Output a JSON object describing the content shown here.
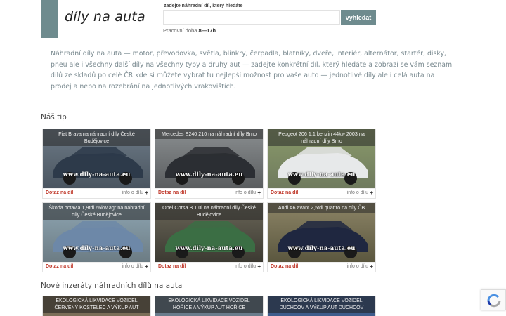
{
  "header": {
    "logo_text": "díly na auta",
    "search_caption": "zadejte náhradní díl, který hledáte",
    "search_placeholder": "",
    "search_button": "vyhledat",
    "hours_label": "Pracovní doba",
    "hours_value": "8—17h"
  },
  "intro": "Náhradní díly na auta — motor, převodovka, světla, blinkry, čerpadla, blatníky, dveře, interiér, alternátor, startér, disky, pneu ale i všechny další díly na všechny typy a druhy aut — zadejte konkrétní díl, který hledáte a zobrazí se vám seznam dílů ze skladů po celé ČR kde si můžete vybrat tu nejlepší možnost pro vaše auto — jednotlivé díly ale i celá auta na prodej a nebo na rozebrání na jednotlivých vrakovištích.",
  "tip_title": "Náš tip",
  "card_common": {
    "ask": "Dotaz na díl",
    "info": "info o dílu",
    "plus": "+",
    "watermark": "www.dily-na-auta.eu"
  },
  "tip_cards": [
    {
      "caption": "Fiat Brava na náhradní díly České Budějovice",
      "top": "#6d7a86",
      "bottom": "#4a5560",
      "car": "#2d3a4a"
    },
    {
      "caption": "Mercedes E240 210 na náhradní díly Brno",
      "top": "#8a8e90",
      "bottom": "#5a5d5f",
      "car": "#2b2e33"
    },
    {
      "caption": "Peugeot 206 1,1 benzin 44kw 2003 na náhradní díly Brno",
      "top": "#8a9a6a",
      "bottom": "#6f7a5e",
      "car": "#e7e9ea"
    },
    {
      "caption": "Škoda octavia 1,9tdi 66kw agr na náhradní díly České Budějovice",
      "top": "#8fa6b3",
      "bottom": "#6c7c84",
      "car": "#6d88a8"
    },
    {
      "caption": "Opel Corsa B 1.0i na náhradní díly České Budějovice",
      "top": "#6a6658",
      "bottom": "#3c3a32",
      "car": "#3b6e44"
    },
    {
      "caption": "Audi A6 avant 2,5tdi quattro na díly ČB",
      "top": "#8c8466",
      "bottom": "#5b573f",
      "car": "#1f2740"
    }
  ],
  "new_title": "Nové inzeráty náhradních dílů na auta",
  "new_cards": [
    {
      "caption": "Ekologická likvidace vozidel červený Kostelec a výkup aut",
      "bg": "#7b6e58"
    },
    {
      "caption": "Ekologická likvidace vozidel Hořice a výkup aut Hořice",
      "bg": "#6a7c8c"
    },
    {
      "caption": "Ekologická likvidace vozidel Duchcov a výkup aut Duchcov",
      "bg": "#3e5c8c"
    }
  ]
}
